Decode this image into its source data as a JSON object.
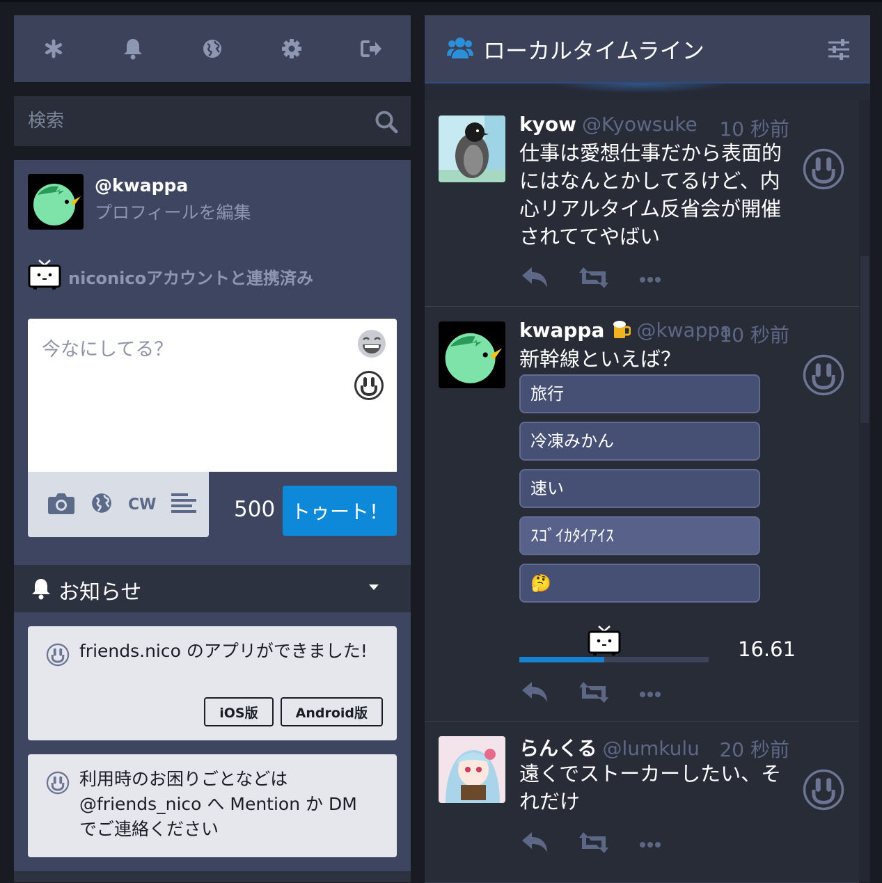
{
  "nav": {
    "items": [
      "getting-started",
      "notifications",
      "public-timeline",
      "settings",
      "logout"
    ]
  },
  "search": {
    "placeholder": "検索"
  },
  "profile": {
    "handle": "@kwappa",
    "edit_label": "プロフィールを編集",
    "niconico_status": "niconicoアカウントと連携済み"
  },
  "compose": {
    "placeholder": "今なにしてる？",
    "cw_label": "CW",
    "char_count": "500",
    "toot_label": "トゥート！"
  },
  "notifications": {
    "title": "お知らせ",
    "items": [
      {
        "text": "friends.nico のアプリができました!",
        "buttons": [
          "iOS版",
          "Android版"
        ]
      },
      {
        "text": "利用時のお困りごとなどは @friends_nico へ Mention か DM でご連絡ください"
      }
    ]
  },
  "timeline": {
    "title": "ローカルタイムライン",
    "statuses": [
      {
        "display_name": "kyow",
        "acct": "@Kyowsuke",
        "time": "10 秒前",
        "content": "仕事は愛想仕事だから表面的にはなんとかしてるけど、内心リアルタイム反省会が開催されててやばい"
      },
      {
        "display_name": "kwappa",
        "acct": "@kwappa",
        "time": "10 秒前",
        "content": "新幹線といえば？",
        "poll": {
          "options": [
            "旅行",
            "冷凍みかん",
            "速い",
            "ｽｺﾞｲｶﾀｲｱｲｽ",
            "🤔"
          ],
          "result_value": "16.61",
          "result_fraction": 0.45
        }
      },
      {
        "display_name": "らんくる",
        "acct": "@lumkulu",
        "time": "20 秒前",
        "content": "遠くでストーカーしたい、それだけ"
      }
    ]
  },
  "colors": {
    "accent": "#0e88d8",
    "panel": "#3e4560",
    "column_bg": "#282c37",
    "muted": "#5d6886"
  }
}
